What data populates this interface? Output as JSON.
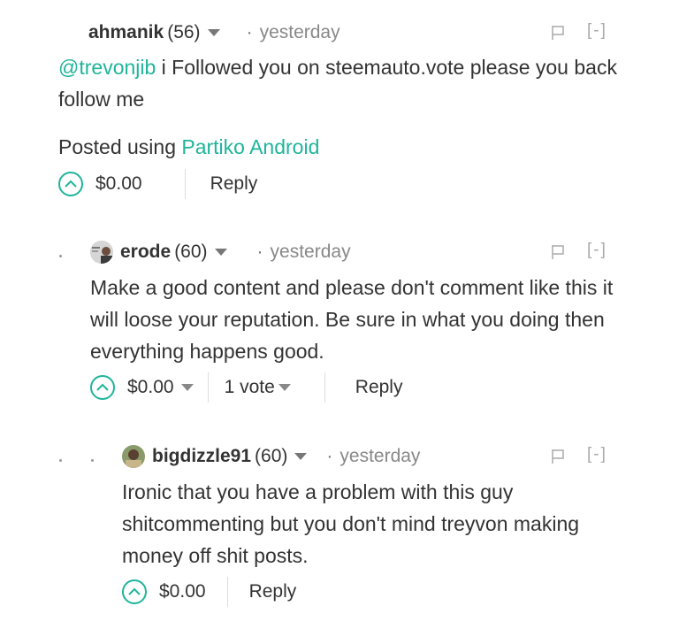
{
  "comments": [
    {
      "author": "ahmanik",
      "rep": "(56)",
      "time": "yesterday",
      "mention": "@trevonjib",
      "text_rest": " i Followed you on steemauto.vote please you back follow me",
      "posted_prefix": "Posted using ",
      "posted_link": "Partiko Android",
      "payout": "$0.00",
      "reply": "Reply",
      "collapse": "[-]"
    },
    {
      "author": "erode",
      "rep": "(60)",
      "time": "yesterday",
      "text": "Make a good content and please don't comment like this it will loose your reputation. Be sure in what you doing then everything happens good.",
      "payout": "$0.00",
      "votes": "1 vote",
      "reply": "Reply",
      "collapse": "[-]"
    },
    {
      "author": "bigdizzle91",
      "rep": "(60)",
      "time": "yesterday",
      "text": "Ironic that you have a problem with this guy shitcommenting but you don't mind treyvon making money off shit posts.",
      "payout": "$0.00",
      "reply": "Reply",
      "collapse": "[-]"
    }
  ],
  "separator": "·",
  "colors": {
    "accent": "#1fb59a",
    "text": "#333333",
    "muted": "#888888"
  },
  "icons": [
    "caret-down-icon",
    "flag-icon",
    "upvote-icon",
    "avatar"
  ]
}
